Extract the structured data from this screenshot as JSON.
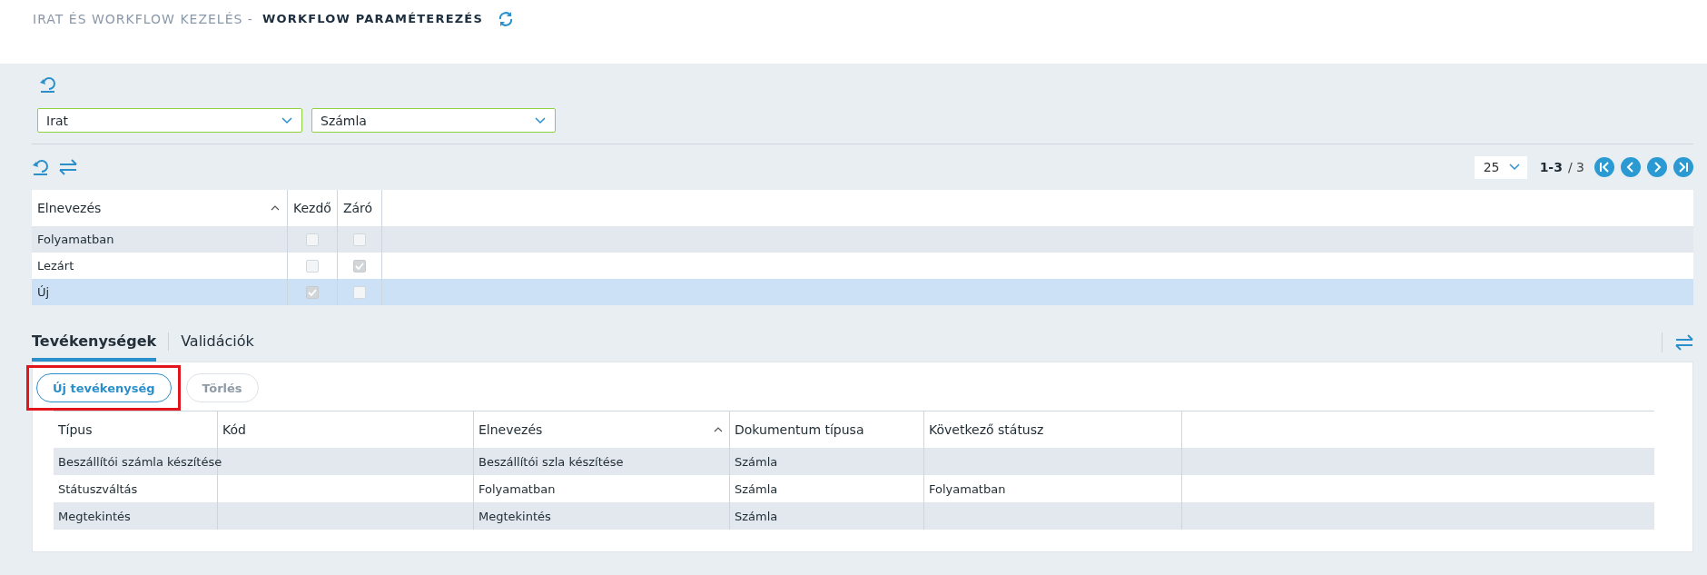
{
  "header": {
    "breadcrumb": "IRAT ÉS WORKFLOW KEZELÉS -",
    "title": "WORKFLOW PARAMÉTEREZÉS"
  },
  "filters": [
    {
      "value": "Irat"
    },
    {
      "value": "Számla"
    }
  ],
  "pager": {
    "page_size": "25",
    "range": "1-3",
    "total": "/ 3"
  },
  "status_table": {
    "columns": [
      {
        "label": "Elnevezés",
        "sorted": true
      },
      {
        "label": "Kezdő",
        "sorted": false
      },
      {
        "label": "Záró",
        "sorted": false
      }
    ],
    "rows": [
      {
        "name": "Folyamatban",
        "start": false,
        "end": false,
        "selected": false
      },
      {
        "name": "Lezárt",
        "start": false,
        "end": true,
        "selected": false
      },
      {
        "name": "Új",
        "start": true,
        "end": false,
        "selected": true
      }
    ]
  },
  "tabs": [
    {
      "label": "Tevékenységek",
      "selected": true
    },
    {
      "label": "Validációk",
      "selected": false
    }
  ],
  "buttons": [
    {
      "label": "Új tevékenység",
      "disabled": false,
      "highlighted": true
    },
    {
      "label": "Törlés",
      "disabled": true,
      "highlighted": false
    }
  ],
  "activity_table": {
    "columns": [
      {
        "label": "Típus",
        "sorted": false
      },
      {
        "label": "Kód",
        "sorted": false
      },
      {
        "label": "Elnevezés",
        "sorted": true
      },
      {
        "label": "Dokumentum típusa",
        "sorted": false
      },
      {
        "label": "Következő státusz",
        "sorted": false
      }
    ],
    "rows": [
      [
        "Beszállítói számla készítése",
        "",
        "Beszállítói szla készítése",
        "Számla",
        ""
      ],
      [
        "Státuszváltás",
        "",
        "Folyamatban",
        "Számla",
        "Folyamatban"
      ],
      [
        "Megtekintés",
        "",
        "Megtekintés",
        "Számla",
        ""
      ]
    ]
  }
}
